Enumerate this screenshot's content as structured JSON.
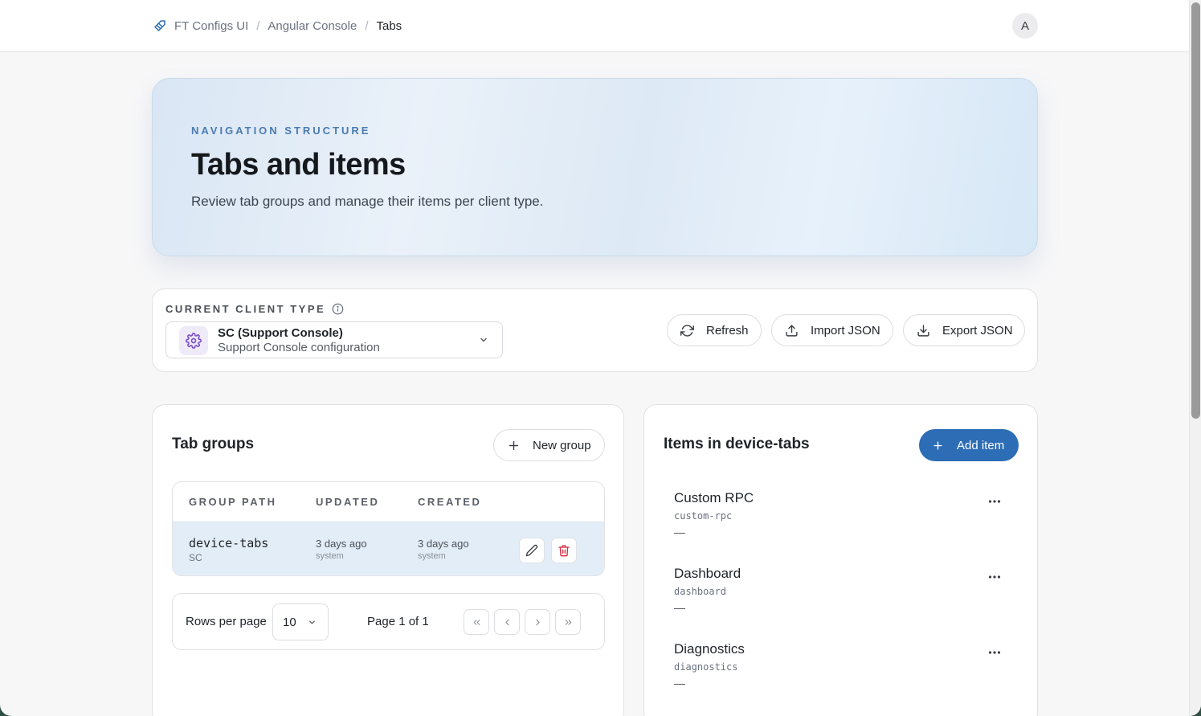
{
  "breadcrumb": {
    "items": [
      "FT Configs UI",
      "Angular Console",
      "Tabs"
    ],
    "separator": "/"
  },
  "user": {
    "avatar_initial": "A"
  },
  "hero": {
    "eyebrow": "NAVIGATION STRUCTURE",
    "title": "Tabs and items",
    "description": "Review tab groups and manage their items per client type."
  },
  "client_type": {
    "label": "CURRENT CLIENT TYPE",
    "selected_name": "SC (Support Console)",
    "selected_description": "Support Console configuration",
    "icon": "gear-icon"
  },
  "actions": {
    "refresh": "Refresh",
    "import": "Import JSON",
    "export": "Export JSON"
  },
  "tab_groups": {
    "title": "Tab groups",
    "new_group_label": "New group",
    "columns": [
      "GROUP PATH",
      "UPDATED",
      "CREATED"
    ],
    "rows": [
      {
        "path": "device-tabs",
        "client": "SC",
        "updated": "3 days ago",
        "updated_by": "system",
        "created": "3 days ago",
        "created_by": "system"
      }
    ],
    "pagination": {
      "rows_per_page_label": "Rows per page",
      "rows_per_page": "10",
      "page_text": "Page 1 of 1"
    }
  },
  "items_panel": {
    "title": "Items in device-tabs",
    "add_label": "Add item",
    "items": [
      {
        "name": "Custom RPC",
        "slug": "custom-rpc",
        "detail": "—"
      },
      {
        "name": "Dashboard",
        "slug": "dashboard",
        "detail": "—"
      },
      {
        "name": "Diagnostics",
        "slug": "diagnostics",
        "detail": "—"
      }
    ]
  },
  "colors": {
    "primary": "#2c6db5",
    "eyebrow": "#4a7bb0",
    "delete": "#d6293e",
    "gear": "#7b4fc9"
  }
}
